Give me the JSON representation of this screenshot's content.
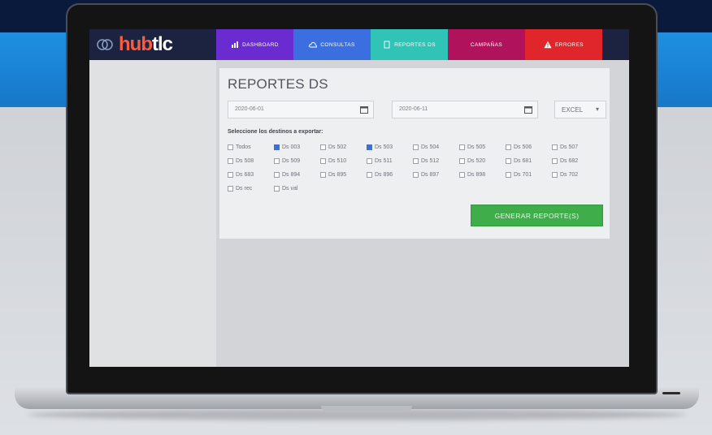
{
  "brand": {
    "logo_part1": "hub",
    "logo_part2": "tlc"
  },
  "nav": {
    "tabs": [
      {
        "label": "Dashboard",
        "color": "#6a2bd1",
        "icon": "bar-chart-icon"
      },
      {
        "label": "Consultas",
        "color": "#3b6fe0",
        "icon": "cloud-icon"
      },
      {
        "label": "Reportes DS",
        "color": "#2fc4b5",
        "icon": "document-icon"
      },
      {
        "label": "Campañas",
        "color": "#b0125c",
        "icon": "none"
      },
      {
        "label": "Errores",
        "color": "#e0262b",
        "icon": "warning-icon"
      }
    ]
  },
  "panel": {
    "title": "REPORTES DS",
    "date_from": "2020-06-01",
    "date_to": "2020-06-11",
    "format": "EXCEL",
    "instruction": "Seleccione los destinos a exportar:",
    "checkboxes": [
      {
        "label": "Todos",
        "checked": false
      },
      {
        "label": "Ds 003",
        "checked": true
      },
      {
        "label": "Ds 502",
        "checked": false
      },
      {
        "label": "Ds 503",
        "checked": true
      },
      {
        "label": "Ds 504",
        "checked": false
      },
      {
        "label": "Ds 505",
        "checked": false
      },
      {
        "label": "Ds 506",
        "checked": false
      },
      {
        "label": "Ds 507",
        "checked": false
      },
      {
        "label": "Ds 508",
        "checked": false
      },
      {
        "label": "Ds 509",
        "checked": false
      },
      {
        "label": "Ds 510",
        "checked": false
      },
      {
        "label": "Ds 511",
        "checked": false
      },
      {
        "label": "Ds 512",
        "checked": false
      },
      {
        "label": "Ds 520",
        "checked": false
      },
      {
        "label": "Ds 681",
        "checked": false
      },
      {
        "label": "Ds 682",
        "checked": false
      },
      {
        "label": "Ds 683",
        "checked": false
      },
      {
        "label": "Ds 894",
        "checked": false
      },
      {
        "label": "Ds 895",
        "checked": false
      },
      {
        "label": "Ds 896",
        "checked": false
      },
      {
        "label": "Ds 897",
        "checked": false
      },
      {
        "label": "Ds 898",
        "checked": false
      },
      {
        "label": "Ds 701",
        "checked": false
      },
      {
        "label": "Ds 702",
        "checked": false
      },
      {
        "label": "Ds rec",
        "checked": false
      },
      {
        "label": "Ds val",
        "checked": false
      }
    ],
    "generate_label": "Generar reporte(s)"
  }
}
